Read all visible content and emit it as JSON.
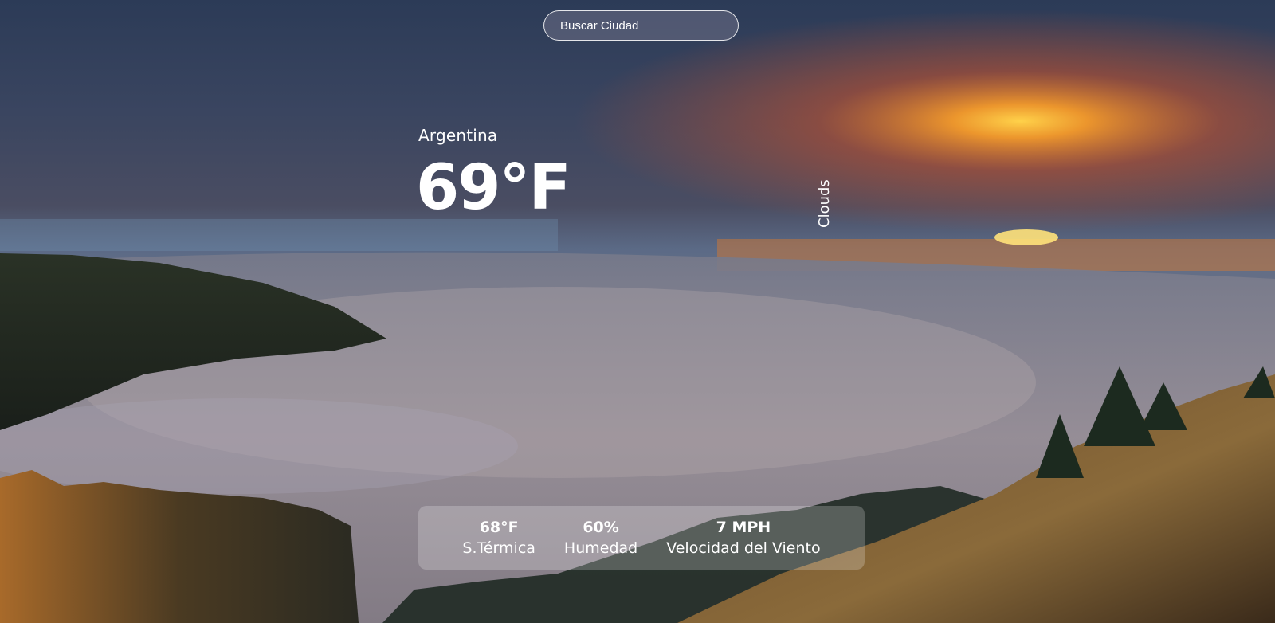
{
  "search": {
    "placeholder": "Buscar Ciudad"
  },
  "weather": {
    "location": "Argentina",
    "temperature": "69°F",
    "description": "Clouds"
  },
  "stats": [
    {
      "value": "68°F",
      "label": "S.Térmica"
    },
    {
      "value": "60%",
      "label": "Humedad"
    },
    {
      "value": "7 MPH",
      "label": "Velocidad del Viento"
    }
  ],
  "colors": {
    "text": "#ffffff",
    "sky_top": "#2e3f5e",
    "sunset": "#f08a24",
    "fog": "#8a8893",
    "forest": "#1e2a22"
  }
}
